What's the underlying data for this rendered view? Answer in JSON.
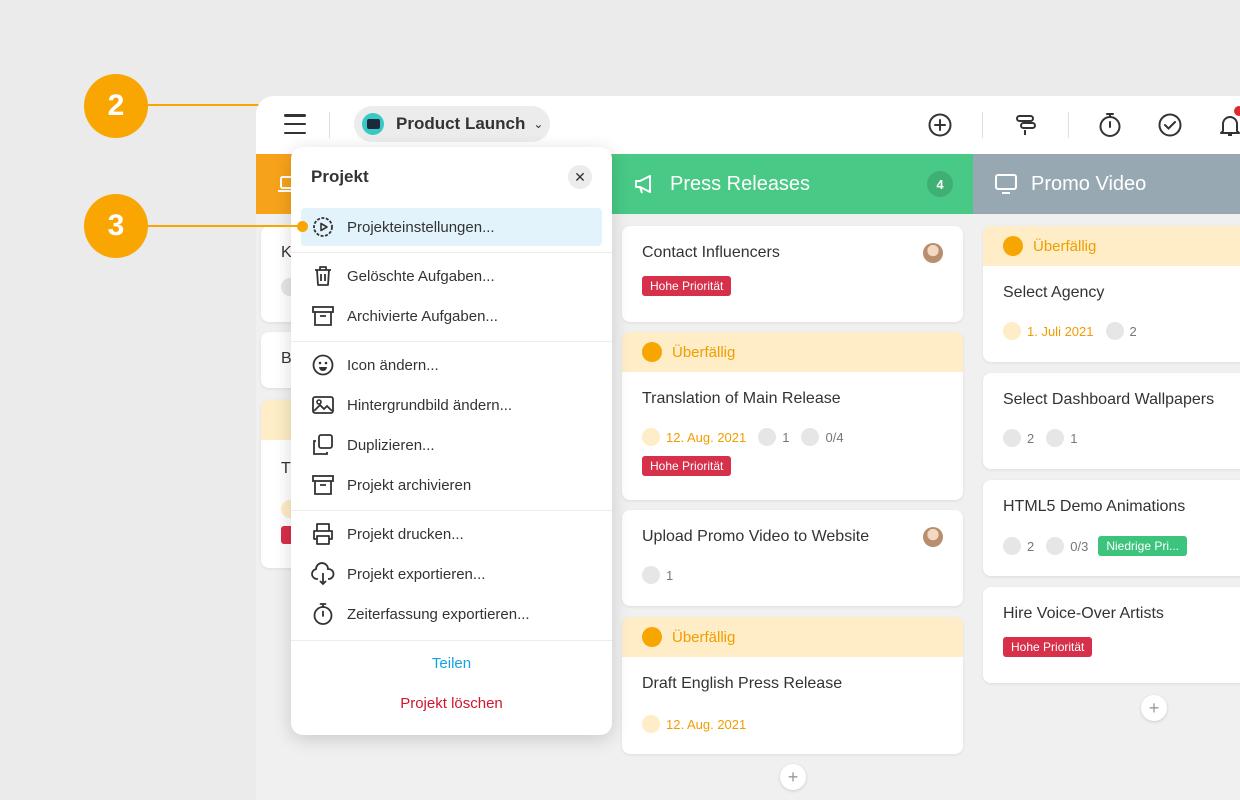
{
  "callouts": [
    "2",
    "3"
  ],
  "topbar": {
    "project_name": "Product Launch",
    "icons": [
      "menu-icon",
      "add-icon",
      "gantt-icon",
      "timer-icon",
      "check-icon",
      "bell-icon"
    ]
  },
  "menu": {
    "title": "Projekt",
    "items": [
      {
        "label": "Projekteinstellungen...",
        "icon": "settings-icon"
      },
      {
        "label": "Gelöschte Aufgaben...",
        "icon": "trash-icon"
      },
      {
        "label": "Archivierte Aufgaben...",
        "icon": "archive-icon"
      },
      {
        "label": "Icon ändern...",
        "icon": "smiley-icon"
      },
      {
        "label": "Hintergrundbild ändern...",
        "icon": "image-icon"
      },
      {
        "label": "Duplizieren...",
        "icon": "duplicate-icon"
      },
      {
        "label": "Projekt archivieren",
        "icon": "archive-icon"
      },
      {
        "label": "Projekt drucken...",
        "icon": "print-icon"
      },
      {
        "label": "Projekt exportieren...",
        "icon": "cloud-download-icon"
      },
      {
        "label": "Zeiterfassung exportieren...",
        "icon": "timer-icon"
      }
    ],
    "share": "Teilen",
    "delete": "Projekt löschen",
    "share_color": "#17a2e0",
    "delete_color": "#d0152d"
  },
  "columns": {
    "left_partial": {
      "color": "#f7a21b",
      "card_initials": [
        "K",
        "B",
        "T"
      ]
    },
    "press": {
      "title": "Press Releases",
      "count": "4",
      "color": "#48c985",
      "cards": {
        "c1": {
          "title": "Contact Influencers",
          "tag": "Hohe Priorität"
        },
        "c2": {
          "overdue": "Überfällig",
          "title": "Translation of Main Release",
          "date": "12. Aug. 2021",
          "comments": "1",
          "checklist": "0/4",
          "tag": "Hohe Priorität"
        },
        "c3": {
          "title": "Upload Promo Video to Website",
          "comments": "1"
        },
        "c4": {
          "overdue": "Überfällig",
          "title": "Draft English Press Release",
          "date": "12. Aug. 2021"
        }
      }
    },
    "promo": {
      "title": "Promo Video",
      "color": "#98a8b3",
      "cards": {
        "c1": {
          "overdue": "Überfällig",
          "title": "Select Agency",
          "date": "1. Juli 2021",
          "comments": "2"
        },
        "c2": {
          "title": "Select Dashboard Wallpapers",
          "comments": "2",
          "attachments": "1"
        },
        "c3": {
          "title": "HTML5 Demo Animations",
          "comments": "2",
          "checklist": "0/3",
          "tag": "Niedrige Pri..."
        },
        "c4": {
          "title": "Hire Voice-Over Artists",
          "tag": "Hohe Priorität"
        }
      }
    }
  },
  "colors": {
    "accent_orange": "#f9a602",
    "overdue_bg": "#feedc6",
    "high_priority": "#d6304a",
    "low_priority": "#3cc47c"
  }
}
